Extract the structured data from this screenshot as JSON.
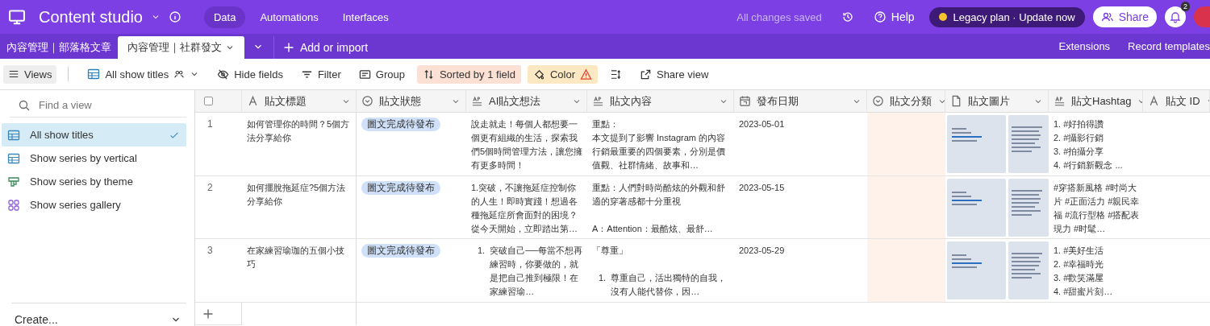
{
  "app": {
    "title": "Content studio",
    "nav": [
      {
        "label": "Data",
        "selected": true
      },
      {
        "label": "Automations",
        "selected": false
      },
      {
        "label": "Interfaces",
        "selected": false
      }
    ],
    "save_status": "All changes saved",
    "help": "Help",
    "plan_button": "Legacy plan · Update now",
    "share": "Share",
    "notifications_badge": "2"
  },
  "tables": [
    {
      "label": "內容管理｜部落格文章",
      "selected": false
    },
    {
      "label": "內容管理｜社群發文",
      "selected": true
    }
  ],
  "add_import": "Add or import",
  "extensions": "Extensions",
  "record_templates": "Record templates",
  "toolbar": {
    "views": "Views",
    "view_name": "All show titles",
    "buttons": [
      {
        "label": "Hide fields",
        "kind": "hide"
      },
      {
        "label": "Filter",
        "kind": "filter"
      },
      {
        "label": "Group",
        "kind": "group"
      },
      {
        "label": "Sorted by 1 field",
        "kind": "sort"
      },
      {
        "label": "Color",
        "kind": "color"
      },
      {
        "kind": "height"
      },
      {
        "label": "Share view",
        "kind": "share"
      }
    ]
  },
  "sidebar": {
    "search_placeholder": "Find a view",
    "views": [
      {
        "label": "All show titles",
        "kind": "grid",
        "selected": true
      },
      {
        "label": "Show series by vertical",
        "kind": "grid",
        "selected": false
      },
      {
        "label": "Show series by theme",
        "kind": "kanban",
        "selected": false
      },
      {
        "label": "Show series gallery",
        "kind": "gallery",
        "selected": false
      }
    ],
    "create": "Create..."
  },
  "table": {
    "select_all_checked": false,
    "columns": [
      {
        "label": "貼文標題",
        "kind": "text",
        "sorted": false
      },
      {
        "label": "貼文狀態",
        "kind": "select",
        "sorted": false
      },
      {
        "label": "AI貼文想法",
        "kind": "longtext",
        "sorted": false
      },
      {
        "label": "貼文內容",
        "kind": "longtext",
        "sorted": false
      },
      {
        "label": "發布日期",
        "kind": "date",
        "sorted": false
      },
      {
        "label": "貼文分類",
        "kind": "select",
        "sorted": true
      },
      {
        "label": "貼文圖片",
        "kind": "attachment",
        "sorted": false
      },
      {
        "label": "貼文Hashtag",
        "kind": "longtext",
        "sorted": false
      },
      {
        "label": "貼文 ID",
        "kind": "text",
        "sorted": false
      }
    ],
    "rows": [
      {
        "number": "1",
        "title": "如何管理你的時間？5個方法分享給你",
        "status": "圖文完成待發布",
        "ai": [
          {
            "kind": "p",
            "text": "說走就走！每個人都想要一個更有組織的生活，探索我們5個時間管理方法，讓您擁有更多時間！"
          }
        ],
        "content": [
          {
            "kind": "p",
            "text": "重點："
          },
          {
            "kind": "p",
            "text": "本文提到了影響 Instagram 的內容行銷最重要的四個要素，分別是價值觀、社群情緒、故事和…"
          }
        ],
        "date": "2023-05-01",
        "attachments": [
          {
            "kind": "cover"
          },
          {
            "kind": "page"
          }
        ],
        "hashtags": [
          {
            "kind": "p",
            "text": "1. #好拍得讚"
          },
          {
            "kind": "p",
            "text": "2. #攝影行銷"
          },
          {
            "kind": "p",
            "text": "3. #拍攝分享"
          },
          {
            "kind": "p",
            "text": "4. #行銷新觀念 ..."
          }
        ]
      },
      {
        "number": "2",
        "title": "如何擺脫拖延症?5個方法分享給你",
        "status": "圖文完成待發布",
        "ai": [
          {
            "kind": "p",
            "text": "1.突破，不讓拖延症控制你的人生！即時實踐！想過各種拖延症所會面對的困境？從今天開始，立即踏出第…"
          }
        ],
        "content": [
          {
            "kind": "p",
            "text": "重點：人們對時尚酷炫的外觀和舒適的穿著感都十分重視"
          },
          {
            "kind": "gap"
          },
          {
            "kind": "p",
            "text": "A：Attention：最酷炫、最舒…"
          }
        ],
        "date": "2023-05-15",
        "attachments": [
          {
            "kind": "cover"
          },
          {
            "kind": "page"
          }
        ],
        "hashtags": [
          {
            "kind": "p",
            "text": "#穿搭新風格 #时尚大片 #正面活力 #親民幸福 #流行型格 #搭配表現力 #时髦…"
          }
        ]
      },
      {
        "number": "3",
        "title": "在家練習瑜珈的五個小技巧",
        "status": "圖文完成待發布",
        "ai": [
          {
            "kind": "li",
            "marker": "1.",
            "text": "突破自己──每當不想再練習時，你要做的，就是把自己推到極限！在家練習瑜…"
          }
        ],
        "content": [
          {
            "kind": "p",
            "text": "「尊重」"
          },
          {
            "kind": "gap"
          },
          {
            "kind": "li",
            "marker": "1.",
            "text": "尊重自己，活出獨特的自我，沒有人能代替你，因…"
          }
        ],
        "date": "2023-05-29",
        "attachments": [
          {
            "kind": "cover"
          },
          {
            "kind": "page"
          }
        ],
        "hashtags": [
          {
            "kind": "p",
            "text": "1. #美好生活"
          },
          {
            "kind": "p",
            "text": "2. #幸福時光"
          },
          {
            "kind": "p",
            "text": "3. #歡笑滿屋"
          },
          {
            "kind": "p",
            "text": "4. #甜蜜片刻…"
          }
        ]
      }
    ]
  }
}
